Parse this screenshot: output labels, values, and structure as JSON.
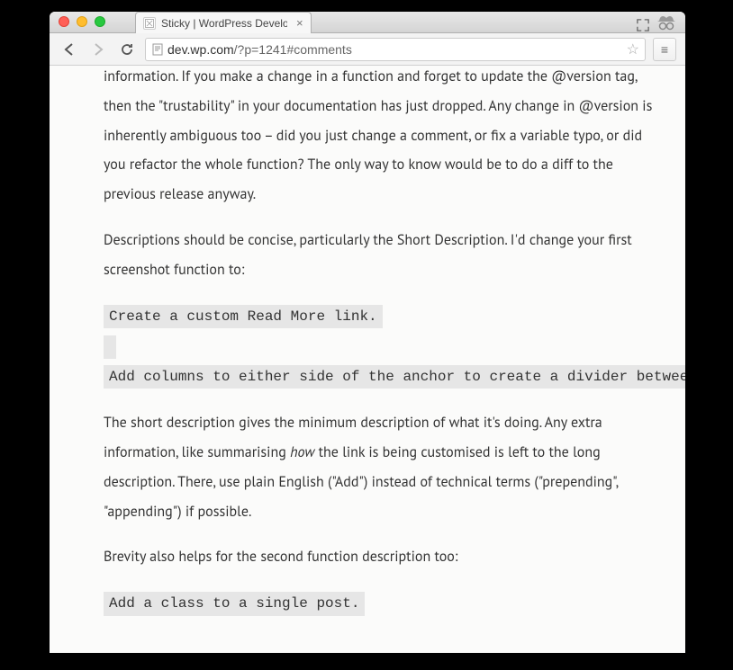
{
  "window": {
    "tab_title": "Sticky | WordPress Develop",
    "url_domain": "dev.wp.com",
    "url_path": "/?p=1241#comments"
  },
  "article": {
    "p1": "information. If you make a change in a function and forget to update the @version tag, then the \"trustability\" in your documentation has just dropped. Any change in @version is inherently ambiguous too – did you just change a comment, or fix a variable typo, or did you refactor the whole function? The only way to know would be to do a diff to the previous release anyway.",
    "p2": "Descriptions should be concise, particularly the Short Description. I'd change your first screenshot function to:",
    "code1_line1": "Create a custom Read More link.",
    "code1_line2": " ",
    "code1_line3": "Add columns to either side of the anchor to create a divider between",
    "p3a": "The short description gives the minimum description of what it's doing. Any extra information, like summarising ",
    "p3_em": "how",
    "p3b": " the link is being customised is left to the long description. There, use plain English (\"Add\") instead of technical terms (\"prepending\", \"appending\") if possible.",
    "p4": "Brevity also helps for the second function description too:",
    "code2": "Add a class to a single post."
  }
}
